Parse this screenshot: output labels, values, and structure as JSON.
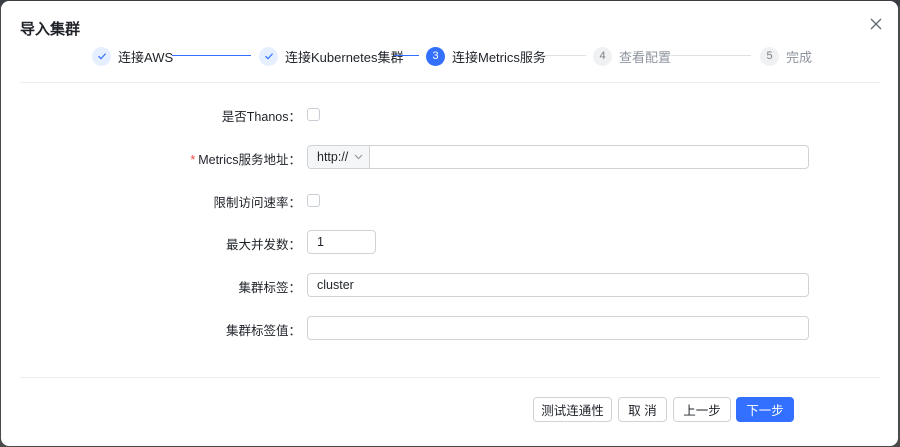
{
  "modal": {
    "title": "导入集群"
  },
  "steps": [
    {
      "label": "连接AWS",
      "status": "done",
      "number": "1"
    },
    {
      "label": "连接Kubernetes集群",
      "status": "done",
      "number": "2"
    },
    {
      "label": "连接Metrics服务",
      "status": "active",
      "number": "3"
    },
    {
      "label": "查看配置",
      "status": "pending",
      "number": "4"
    },
    {
      "label": "完成",
      "status": "pending",
      "number": "5"
    }
  ],
  "form": {
    "thanos": {
      "label": "是否Thanos",
      "checked": false
    },
    "metrics_address": {
      "label": "Metrics服务地址",
      "required_mark": "*",
      "protocol": "http://",
      "value": ""
    },
    "rate_limit": {
      "label": "限制访问速率",
      "checked": false
    },
    "max_concurrency": {
      "label": "最大并发数",
      "value": "1"
    },
    "cluster_label": {
      "label": "集群标签",
      "value": "cluster"
    },
    "cluster_label_value": {
      "label": "集群标签值",
      "value": ""
    },
    "label_suffix": "："
  },
  "footer": {
    "test_label": "测试连通性",
    "cancel_label": "取 消",
    "prev_label": "上一步",
    "next_label": "下一步"
  },
  "colors": {
    "primary": "#3370ff",
    "required": "#f54a45",
    "border": "#d0d3d6"
  }
}
